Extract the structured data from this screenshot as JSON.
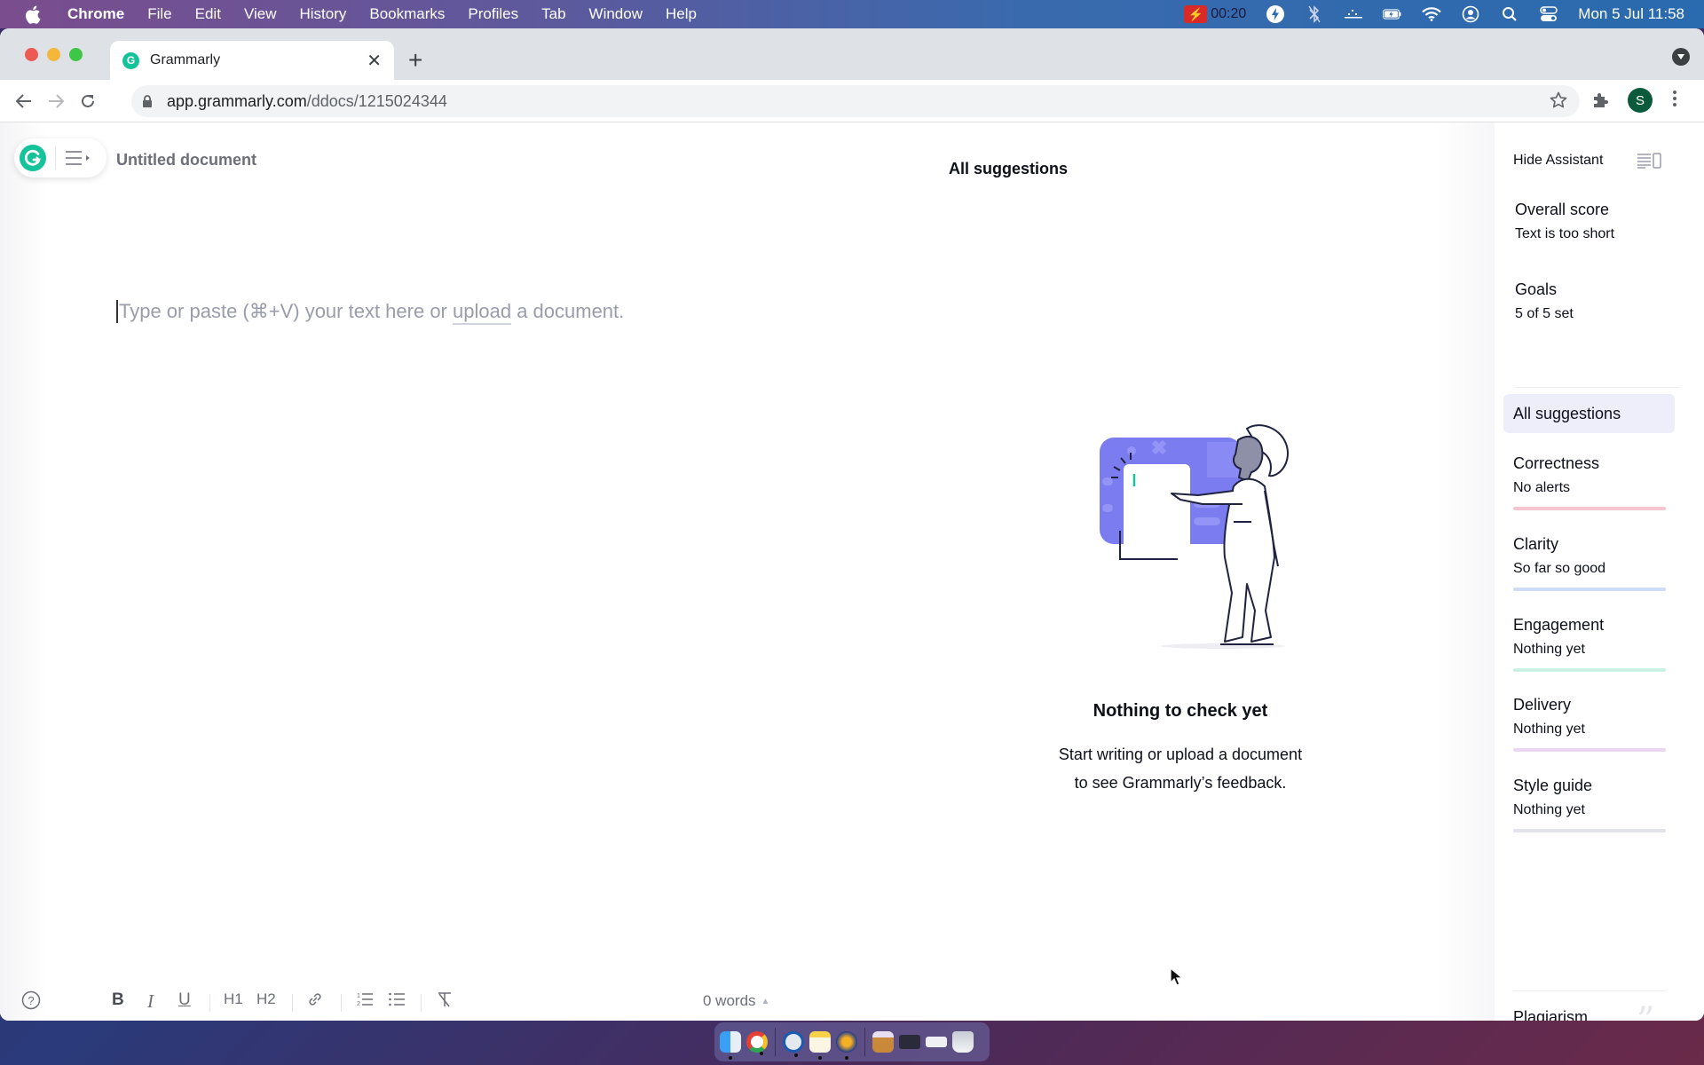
{
  "menubar": {
    "app_name": "Chrome",
    "items": [
      "File",
      "Edit",
      "View",
      "History",
      "Bookmarks",
      "Profiles",
      "Tab",
      "Window",
      "Help"
    ],
    "recording_time": "00:20",
    "datetime": "Mon 5 Jul  11:58",
    "status_icons": [
      "recording-icon",
      "bolt-icon",
      "bluetooth-icon",
      "dots-icon",
      "battery-icon",
      "wifi-icon",
      "user-icon",
      "search-icon",
      "control-center-icon"
    ]
  },
  "browser": {
    "tab_title": "Grammarly",
    "url_host": "app.grammarly.com",
    "url_path": "/ddocs/1215024344",
    "profile_initial": "S"
  },
  "app": {
    "doc_title": "Untitled document",
    "editor_placeholder": {
      "before": "Type or paste (⌘+V) your text here or ",
      "link": "upload",
      "after": " a document."
    },
    "panel_title": "All suggestions",
    "empty_state": {
      "title": "Nothing to check yet",
      "line1": "Start writing or upload a document",
      "line2": "to see Grammarly’s feedback."
    },
    "toolbar": {
      "help": "?",
      "bold": "B",
      "italic": "I",
      "underline": "U",
      "h1": "H1",
      "h2": "H2",
      "word_count": "0 words"
    }
  },
  "sidebar": {
    "hide_assistant": "Hide Assistant",
    "overall_score": {
      "label": "Overall score",
      "value": "Text is too short"
    },
    "goals": {
      "label": "Goals",
      "value": "5 of 5 set"
    },
    "all_suggestions": "All suggestions",
    "categories": [
      {
        "label": "Correctness",
        "status": "No alerts",
        "color": "#f5c6d2"
      },
      {
        "label": "Clarity",
        "status": "So far so good",
        "color": "#cfdcf5"
      },
      {
        "label": "Engagement",
        "status": "Nothing yet",
        "color": "#c9f2e4"
      },
      {
        "label": "Delivery",
        "status": "Nothing yet",
        "color": "#ecd6f2"
      },
      {
        "label": "Style guide",
        "status": "Nothing yet",
        "color": "#e2e2ee"
      }
    ],
    "plagiarism": "Plagiarism"
  },
  "colors": {
    "grammarly_green": "#15c39a",
    "illustration_purple": "#7b7cf0",
    "profile_green": "#0c5a3c"
  },
  "dock": {
    "apps": [
      "Finder",
      "Chrome",
      "1Password",
      "Notes",
      "Reeder",
      "Archive",
      "Chrome window",
      "Window preview",
      "Trash"
    ]
  }
}
